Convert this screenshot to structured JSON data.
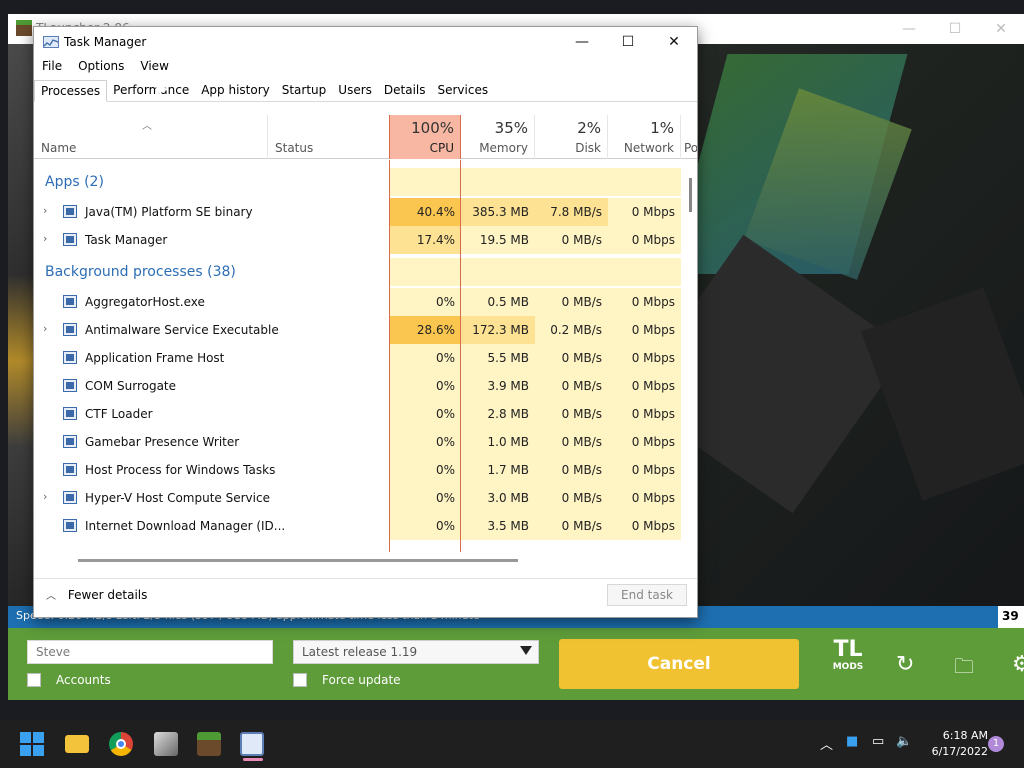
{
  "launcher": {
    "title": "TLauncher 2.86",
    "status_text": "Speed: 0.26 MB/s  Left: 2/3 files (397 / 518 MB) approximate time less than a minute",
    "status_right": "39",
    "username": "Steve",
    "version": "Latest release 1.19",
    "accounts_label": "Accounts",
    "force_update_label": "Force update",
    "cancel_label": "Cancel",
    "logo_text_top": "TL",
    "logo_text_bottom": "MODS"
  },
  "taskmanager": {
    "title": "Task Manager",
    "menu": [
      "File",
      "Options",
      "View"
    ],
    "tabs": [
      "Processes",
      "Performance",
      "App history",
      "Startup",
      "Users",
      "Details",
      "Services"
    ],
    "active_tab": "Processes",
    "columns": {
      "name": "Name",
      "status": "Status",
      "cpu": {
        "pct": "100%",
        "label": "CPU"
      },
      "memory": {
        "pct": "35%",
        "label": "Memory"
      },
      "disk": {
        "pct": "2%",
        "label": "Disk"
      },
      "network": {
        "pct": "1%",
        "label": "Network"
      },
      "power_cut": "Po"
    },
    "groups": {
      "apps": "Apps (2)",
      "background": "Background processes (38)"
    },
    "apps": [
      {
        "name": "Java(TM) Platform SE binary",
        "expandable": true,
        "cpu": "40.4%",
        "memory": "385.3 MB",
        "disk": "7.8 MB/s",
        "network": "0 Mbps"
      },
      {
        "name": "Task Manager",
        "expandable": true,
        "cpu": "17.4%",
        "memory": "19.5 MB",
        "disk": "0 MB/s",
        "network": "0 Mbps"
      }
    ],
    "background": [
      {
        "name": "AggregatorHost.exe",
        "expandable": false,
        "cpu": "0%",
        "memory": "0.5 MB",
        "disk": "0 MB/s",
        "network": "0 Mbps"
      },
      {
        "name": "Antimalware Service Executable",
        "expandable": true,
        "cpu": "28.6%",
        "memory": "172.3 MB",
        "disk": "0.2 MB/s",
        "network": "0 Mbps"
      },
      {
        "name": "Application Frame Host",
        "expandable": false,
        "cpu": "0%",
        "memory": "5.5 MB",
        "disk": "0 MB/s",
        "network": "0 Mbps"
      },
      {
        "name": "COM Surrogate",
        "expandable": false,
        "cpu": "0%",
        "memory": "3.9 MB",
        "disk": "0 MB/s",
        "network": "0 Mbps"
      },
      {
        "name": "CTF Loader",
        "expandable": false,
        "cpu": "0%",
        "memory": "2.8 MB",
        "disk": "0 MB/s",
        "network": "0 Mbps"
      },
      {
        "name": "Gamebar Presence Writer",
        "expandable": false,
        "cpu": "0%",
        "memory": "1.0 MB",
        "disk": "0 MB/s",
        "network": "0 Mbps"
      },
      {
        "name": "Host Process for Windows Tasks",
        "expandable": false,
        "cpu": "0%",
        "memory": "1.7 MB",
        "disk": "0 MB/s",
        "network": "0 Mbps"
      },
      {
        "name": "Hyper-V Host Compute Service",
        "expandable": true,
        "cpu": "0%",
        "memory": "3.0 MB",
        "disk": "0 MB/s",
        "network": "0 Mbps"
      },
      {
        "name": "Internet Download Manager (ID...",
        "expandable": false,
        "cpu": "0%",
        "memory": "3.5 MB",
        "disk": "0 MB/s",
        "network": "0 Mbps"
      }
    ],
    "fewer_details": "Fewer details",
    "end_task": "End task"
  },
  "taskbar": {
    "time": "6:18 AM",
    "date": "6/17/2022",
    "notification_count": "1",
    "icons": [
      "windows-start-icon",
      "file-explorer-icon",
      "chrome-icon",
      "minecraft-tool-icon",
      "tlauncher-icon",
      "task-manager-icon"
    ]
  },
  "colors": {
    "cpu_header": "#f7b7a3",
    "cpu_high": "#fbc650",
    "cpu_mid": "#fde293",
    "cell_low": "#fff4c4",
    "launcher_green": "#5e9c3a",
    "cancel_yellow": "#f0c232",
    "group_blue": "#2d6db5"
  }
}
